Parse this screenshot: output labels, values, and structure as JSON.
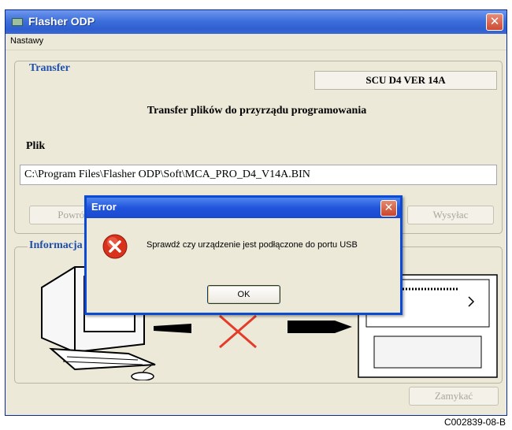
{
  "window": {
    "title": "Flasher ODP",
    "close_symbol": "✕"
  },
  "menu": {
    "items": [
      "Nastawy"
    ]
  },
  "transfer": {
    "legend": "Transfer",
    "version": "SCU D4 VER 14A",
    "subtitle": "Transfer plików do przyrządu programowania",
    "file_label": "Plik",
    "file_path": "C:\\Program Files\\Flasher ODP\\Soft\\MCA_PRO_D4_V14A.BIN",
    "buttons": {
      "back": "Powrót",
      "send": "Wysyłac"
    }
  },
  "info": {
    "legend": "Informacja"
  },
  "footer": {
    "close_button": "Zamykać"
  },
  "dialog": {
    "title": "Error",
    "close_symbol": "✕",
    "message": "Sprawdź czy urządzenie jest podłączone do portu USB",
    "ok": "OK",
    "icon": "error-icon"
  },
  "caption": "C002839-08-B"
}
